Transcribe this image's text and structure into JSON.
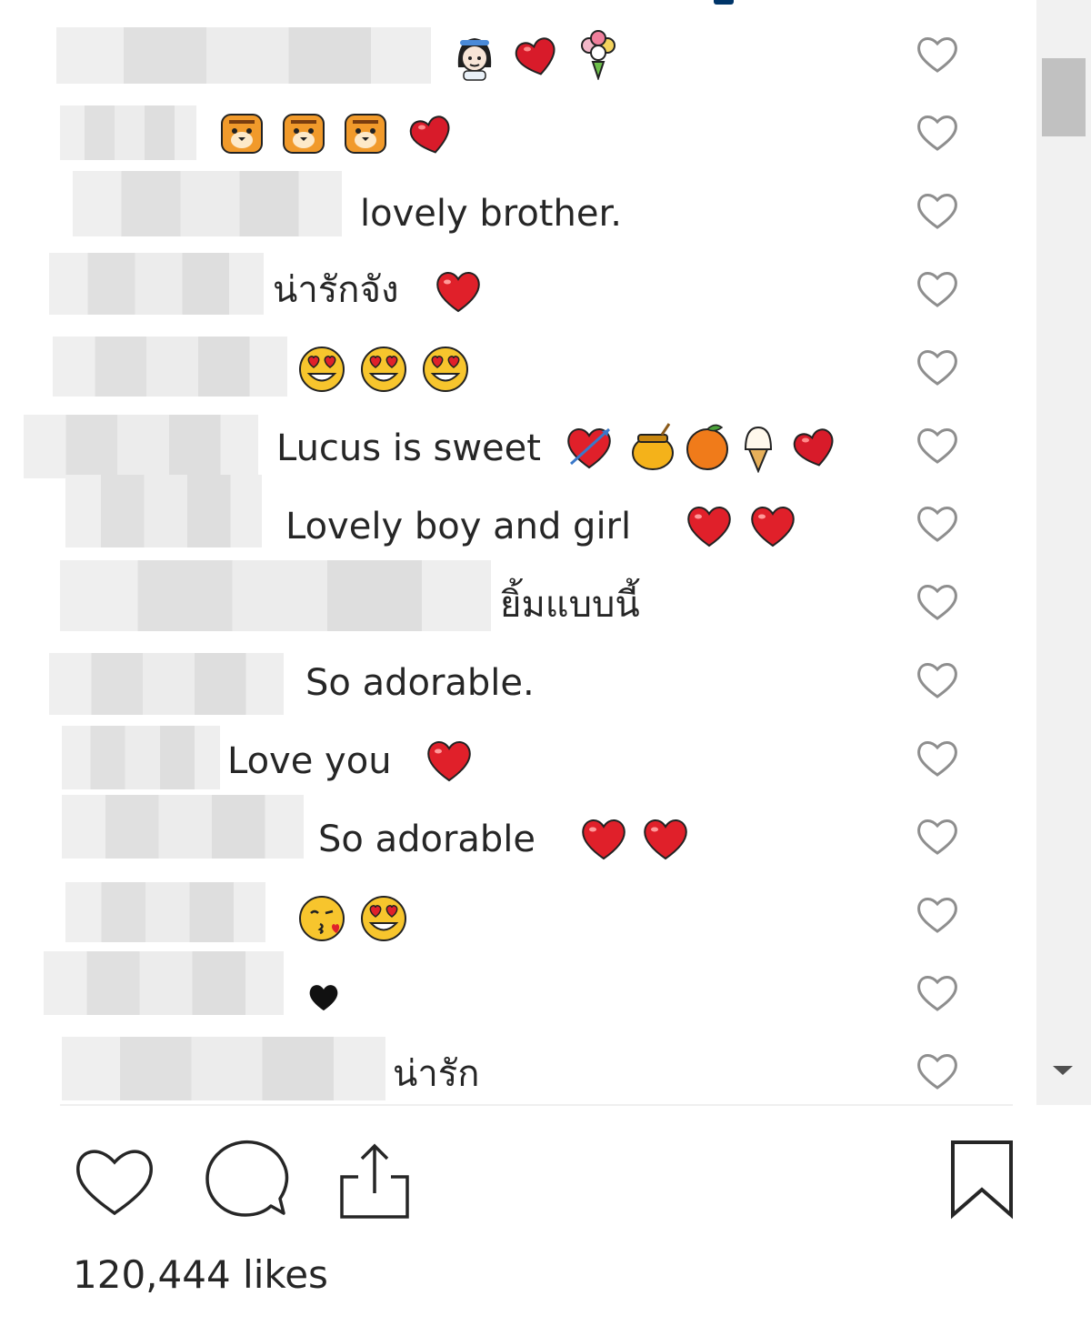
{
  "comments": [
    {
      "text": "",
      "emojis": [
        "woman-emoji",
        "heart-emoji",
        "bouquet-emoji"
      ]
    },
    {
      "text": "",
      "emojis": [
        "tiger-emoji",
        "tiger-emoji",
        "tiger-emoji",
        "heart-emoji"
      ]
    },
    {
      "text": "lovely brother.",
      "emojis": []
    },
    {
      "text": "น่ารักจัง",
      "emojis": [
        "red-heart-emoji"
      ]
    },
    {
      "text": "",
      "emojis": [
        "heart-eyes-emoji",
        "heart-eyes-emoji",
        "heart-eyes-emoji"
      ]
    },
    {
      "text": "Lucus is sweet",
      "emojis": [
        "heart-arrow-emoji",
        "honey-pot-emoji",
        "tangerine-emoji",
        "ice-cream-emoji",
        "heart-emoji"
      ]
    },
    {
      "text": "Lovely boy and girl",
      "emojis": [
        "red-heart-emoji",
        "red-heart-emoji"
      ]
    },
    {
      "text": "ยิ้มแบบนี้",
      "emojis": []
    },
    {
      "text": "So adorable.",
      "emojis": []
    },
    {
      "text": "Love you",
      "emojis": [
        "red-heart-emoji"
      ]
    },
    {
      "text": "So adorable",
      "emojis": [
        "red-heart-emoji",
        "red-heart-emoji"
      ]
    },
    {
      "text": "",
      "emojis": [
        "kissing-face-emoji",
        "heart-eyes-emoji"
      ]
    },
    {
      "text": "",
      "emojis": [
        "black-heart-emoji"
      ]
    },
    {
      "text": "น่ารัก",
      "emojis": []
    }
  ],
  "actions": {
    "like_icon": "heart-outline-icon",
    "comment_icon": "comment-bubble-icon",
    "share_icon": "share-upload-icon",
    "save_icon": "bookmark-icon"
  },
  "likes_label": "120,444 likes",
  "colors": {
    "text": "#262626",
    "icon": "#262626",
    "like_icon_small": "#8e8e8e",
    "heart_red": "#e0202a",
    "blur": "#e7e7e7"
  }
}
